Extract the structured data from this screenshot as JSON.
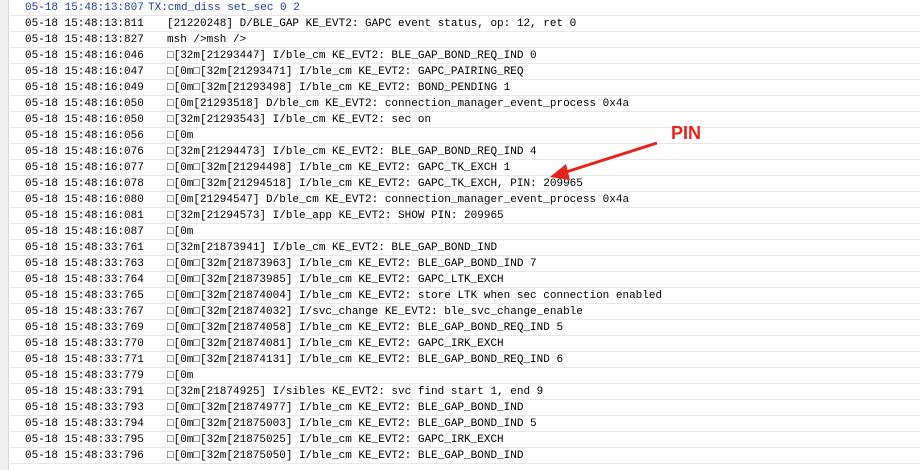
{
  "log": {
    "rows": [
      {
        "ts": "05-18 15:48:13:807",
        "msg": "TX:cmd_diss set_sec 0 2",
        "kind": "tx"
      },
      {
        "ts": "05-18 15:48:13:811",
        "msg": "[21220248] D/BLE_GAP KE_EVT2: GAPC event status, op: 12, ret 0",
        "kind": "rx"
      },
      {
        "ts": "05-18 15:48:13:827",
        "msg": "msh />msh />",
        "kind": "rx"
      },
      {
        "ts": "05-18 15:48:16:046",
        "msg": "□[32m[21293447] I/ble_cm KE_EVT2: BLE_GAP_BOND_REQ_IND 0",
        "kind": "rx"
      },
      {
        "ts": "05-18 15:48:16:047",
        "msg": "□[0m□[32m[21293471] I/ble_cm KE_EVT2: GAPC_PAIRING_REQ",
        "kind": "rx"
      },
      {
        "ts": "05-18 15:48:16:049",
        "msg": "□[0m□[32m[21293498] I/ble_cm KE_EVT2: BOND_PENDING 1",
        "kind": "rx"
      },
      {
        "ts": "05-18 15:48:16:050",
        "msg": "□[0m[21293518] D/ble_cm KE_EVT2: connection_manager_event_process 0x4a",
        "kind": "rx"
      },
      {
        "ts": "05-18 15:48:16:050",
        "msg": "□[32m[21293543] I/ble_cm KE_EVT2: sec on",
        "kind": "rx"
      },
      {
        "ts": "05-18 15:48:16:056",
        "msg": "□[0m",
        "kind": "rx"
      },
      {
        "ts": "05-18 15:48:16:076",
        "msg": "□[32m[21294473] I/ble_cm KE_EVT2: BLE_GAP_BOND_REQ_IND 4",
        "kind": "rx"
      },
      {
        "ts": "05-18 15:48:16:077",
        "msg": "□[0m□[32m[21294498] I/ble_cm KE_EVT2: GAPC_TK_EXCH 1",
        "kind": "rx"
      },
      {
        "ts": "05-18 15:48:16:078",
        "msg": "□[0m□[32m[21294518] I/ble_cm KE_EVT2: GAPC_TK_EXCH, PIN: 209965",
        "kind": "rx"
      },
      {
        "ts": "05-18 15:48:16:080",
        "msg": "□[0m[21294547] D/ble_cm KE_EVT2: connection_manager_event_process 0x4a",
        "kind": "rx"
      },
      {
        "ts": "05-18 15:48:16:081",
        "msg": "□[32m[21294573] I/ble_app KE_EVT2: SHOW PIN: 209965",
        "kind": "rx"
      },
      {
        "ts": "05-18 15:48:16:087",
        "msg": "□[0m",
        "kind": "rx"
      },
      {
        "ts": "05-18 15:48:33:761",
        "msg": "□[32m[21873941] I/ble_cm KE_EVT2: BLE_GAP_BOND_IND",
        "kind": "rx"
      },
      {
        "ts": "05-18 15:48:33:763",
        "msg": "□[0m□[32m[21873963] I/ble_cm KE_EVT2: BLE_GAP_BOND_IND 7",
        "kind": "rx"
      },
      {
        "ts": "05-18 15:48:33:764",
        "msg": "□[0m□[32m[21873985] I/ble_cm KE_EVT2: GAPC_LTK_EXCH",
        "kind": "rx"
      },
      {
        "ts": "05-18 15:48:33:765",
        "msg": "□[0m□[32m[21874004] I/ble_cm KE_EVT2: store LTK when sec connection enabled",
        "kind": "rx"
      },
      {
        "ts": "05-18 15:48:33:767",
        "msg": "□[0m□[32m[21874032] I/svc_change KE_EVT2: ble_svc_change_enable",
        "kind": "rx"
      },
      {
        "ts": "05-18 15:48:33:769",
        "msg": "□[0m□[32m[21874058] I/ble_cm KE_EVT2: BLE_GAP_BOND_REQ_IND 5",
        "kind": "rx"
      },
      {
        "ts": "05-18 15:48:33:770",
        "msg": "□[0m□[32m[21874081] I/ble_cm KE_EVT2: GAPC_IRK_EXCH",
        "kind": "rx"
      },
      {
        "ts": "05-18 15:48:33:771",
        "msg": "□[0m□[32m[21874131] I/ble_cm KE_EVT2: BLE_GAP_BOND_REQ_IND 6",
        "kind": "rx"
      },
      {
        "ts": "05-18 15:48:33:779",
        "msg": "□[0m",
        "kind": "rx"
      },
      {
        "ts": "05-18 15:48:33:791",
        "msg": "□[32m[21874925] I/sibles KE_EVT2: svc find start 1, end 9",
        "kind": "rx"
      },
      {
        "ts": "05-18 15:48:33:793",
        "msg": "□[0m□[32m[21874977] I/ble_cm KE_EVT2: BLE_GAP_BOND_IND",
        "kind": "rx"
      },
      {
        "ts": "05-18 15:48:33:794",
        "msg": "□[0m□[32m[21875003] I/ble_cm KE_EVT2: BLE_GAP_BOND_IND 5",
        "kind": "rx"
      },
      {
        "ts": "05-18 15:48:33:795",
        "msg": "□[0m□[32m[21875025] I/ble_cm KE_EVT2: GAPC_IRK_EXCH",
        "kind": "rx"
      },
      {
        "ts": "05-18 15:48:33:796",
        "msg": "□[0m□[32m[21875050] I/ble_cm KE_EVT2: BLE_GAP_BOND_IND",
        "kind": "rx"
      }
    ]
  },
  "annotation": {
    "label": "PIN",
    "color": "#e8231f"
  },
  "colors": {
    "tx_text": "#1e3c9c",
    "rx_text": "#000000"
  }
}
